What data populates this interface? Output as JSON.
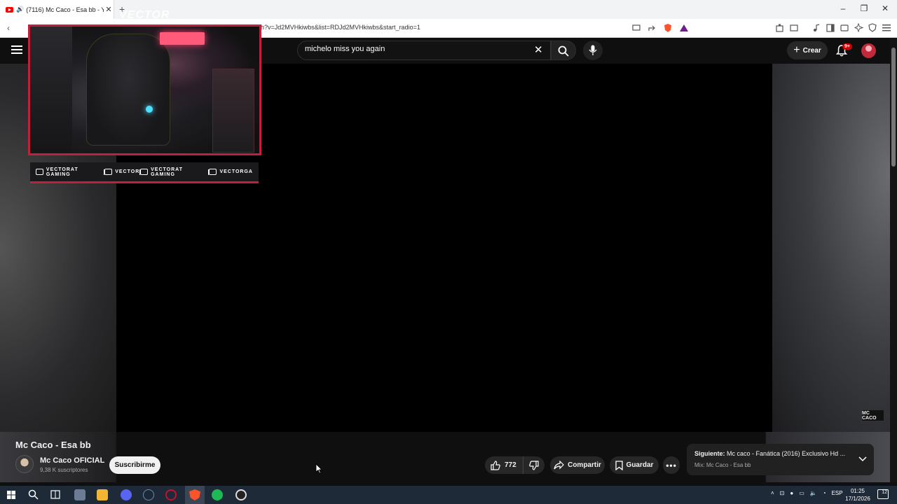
{
  "browser": {
    "tab_title": "(7116) Mc Caco - Esa bb - Yo",
    "url": "h?v=Jd2MVHkiwbs&list=RDJd2MVHkiwbs&start_radio=1"
  },
  "youtube": {
    "search_value": "michelo miss you again",
    "create_label": "Crear",
    "notification_badge": "9+"
  },
  "overlay": {
    "brand": "VECTOR",
    "socials": [
      {
        "label": "VECTORAT GAMING"
      },
      {
        "label": "VECTOR"
      },
      {
        "label": "VECTORAT GAMING"
      },
      {
        "label": "VECTORGA"
      }
    ]
  },
  "player": {
    "watermark": "MC CACO"
  },
  "video": {
    "title": "Mc Caco - Esa bb",
    "channel": "Mc Caco OFICIAL",
    "subscribers": "9,38 K suscriptores",
    "subscribe_label": "Suscribirme",
    "likes": "772",
    "share_label": "Compartir",
    "save_label": "Guardar"
  },
  "next": {
    "prefix": "Siguiente:",
    "title": "Mc caco - Fanática (2016) Exclusivo Hd ...",
    "mix": "Mix: Mc Caco - Esa bb"
  },
  "taskbar": {
    "lang": "ESP",
    "time": "01:25",
    "date": "17/1/2026",
    "notif_count": "12"
  },
  "colors": {
    "accent": "#c0203a",
    "youtube_red": "#ff0000"
  }
}
